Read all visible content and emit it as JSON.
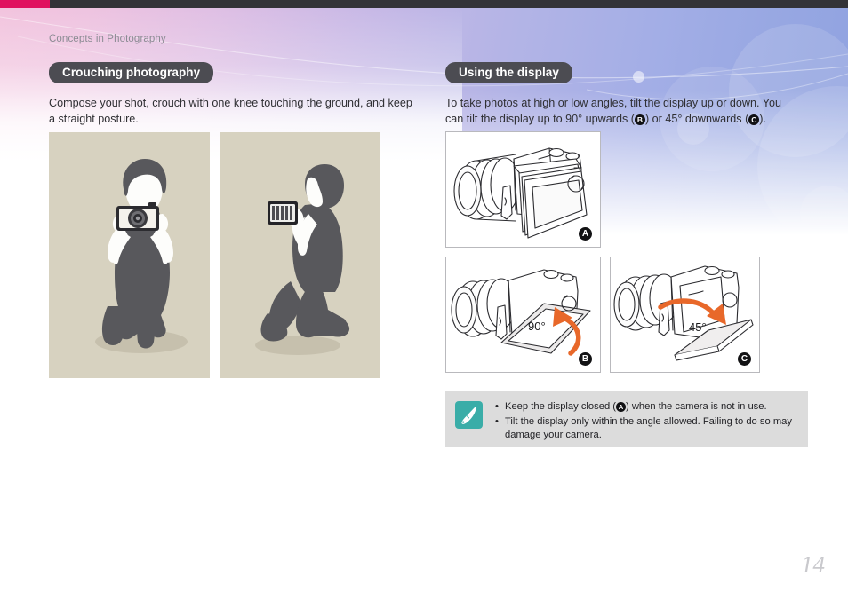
{
  "document": {
    "breadcrumb": "Concepts in Photography",
    "page_number": "14"
  },
  "theme": {
    "accent_pink": "#e0115f",
    "topbar_dark": "#333338",
    "pill_dark": "#4c4c52",
    "note_bg": "#dcdcdc",
    "note_icon_teal": "#3aada8",
    "illustration_bg": "#d7d2c0",
    "figure_border": "#b9b9bd",
    "gradient_from": "#f2c4de",
    "gradient_to": "#8fa2e0"
  },
  "left_column": {
    "heading": "Crouching photography",
    "paragraph": "Compose your shot, crouch with one knee touching the ground, and keep a straight posture.",
    "illustrations": [
      {
        "name": "crouching-photographer-front-view",
        "alt": "Photographer crouching, front view, holding camera to eye"
      },
      {
        "name": "crouching-photographer-side-view",
        "alt": "Photographer kneeling, side view, holding camera"
      }
    ]
  },
  "right_column": {
    "heading": "Using the display",
    "paragraph_part1": "To take photos at high or low angles, tilt the display up or down. You can tilt the display up to 90° upwards (",
    "paragraph_badge1": "B",
    "paragraph_part2": ") or 45° downwards (",
    "paragraph_badge2": "C",
    "paragraph_part3": ").",
    "figures": [
      {
        "label": "A",
        "angle": "",
        "alt": "Camera with display closed flat against the body"
      },
      {
        "label": "B",
        "angle": "90°",
        "alt": "Camera with display tilted 90 degrees upwards"
      },
      {
        "label": "C",
        "angle": "45°",
        "alt": "Camera with display tilted 45 degrees downwards"
      }
    ],
    "note": {
      "icon": "note-pen-icon",
      "items": [
        {
          "before": "Keep the display closed (",
          "badge": "A",
          "after": ") when the camera is not in use."
        },
        {
          "before": "Tilt the display only within the angle allowed. Failing to do so may damage your camera.",
          "badge": "",
          "after": ""
        }
      ]
    }
  }
}
